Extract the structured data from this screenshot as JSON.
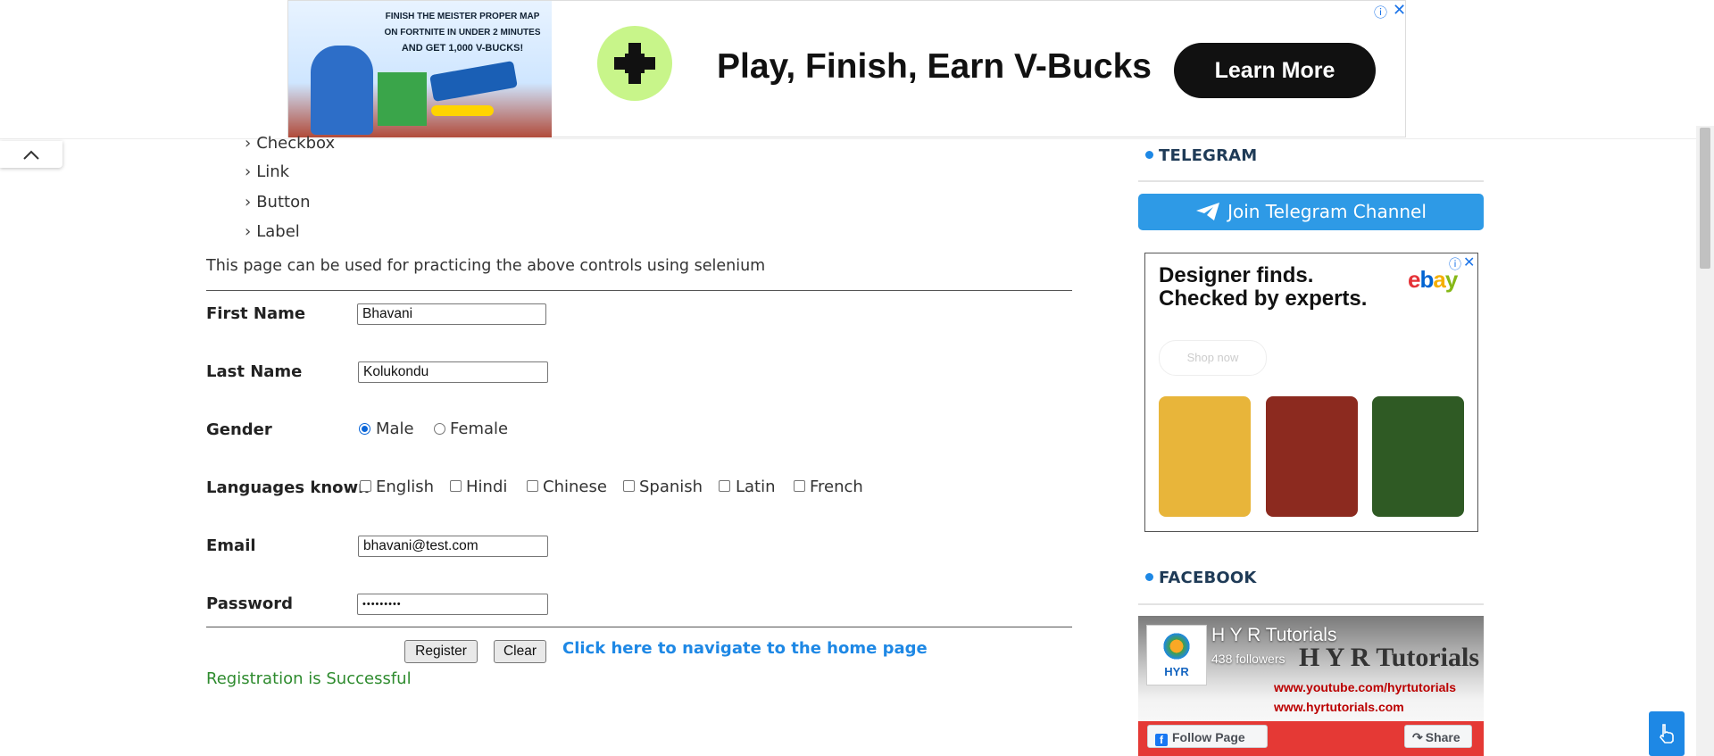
{
  "top_ad": {
    "image_lines": [
      "FINISH THE MEISTER PROPER MAP",
      "ON FORTNITE IN UNDER 2 MINUTES",
      "AND GET 1,000 V-BUCKS!"
    ],
    "headline": "Play, Finish, Earn V-Bucks",
    "cta": "Learn More",
    "info_icon": "info-icon",
    "close_icon": "close-icon"
  },
  "nav_items": [
    "Checkbox",
    "Link",
    "Button",
    "Label"
  ],
  "intro_text": "This page can be used for practicing the above controls using selenium",
  "form": {
    "first_name_label": "First Name",
    "first_name_value": "Bhavani",
    "last_name_label": "Last Name",
    "last_name_value": "Kolukondu",
    "gender_label": "Gender",
    "gender_options": [
      "Male",
      "Female"
    ],
    "gender_selected": "Male",
    "languages_label": "Languages known",
    "languages": [
      "English",
      "Hindi",
      "Chinese",
      "Spanish",
      "Latin",
      "French"
    ],
    "email_label": "Email",
    "email_value": "bhavani@test.com",
    "password_label": "Password",
    "password_value": "•••••••••",
    "register_label": "Register",
    "clear_label": "Clear",
    "home_link": "Click here to navigate to the home page",
    "success_message": "Registration is Successful"
  },
  "sidebar": {
    "telegram_title": "TELEGRAM",
    "telegram_button": "Join Telegram Channel",
    "ebay_ad": {
      "headline_line1": "Designer finds.",
      "headline_line2": "Checked by experts.",
      "logo": "ebay",
      "shop_button": "Shop now"
    },
    "facebook_title": "FACEBOOK",
    "facebook_widget": {
      "page_name": "H Y R Tutorials",
      "followers": "438 followers",
      "banner_title": "H Y R Tutorials",
      "banner_url1": "www.youtube.com/hyrtutorials",
      "banner_url2": "www.hyrtutorials.com",
      "logo_text": "HYR",
      "follow_button": "Follow Page",
      "share_button": "Share"
    }
  },
  "colors": {
    "accent": "#1e88e5",
    "success": "#2e8b2e",
    "telegram": "#2e9ae6"
  }
}
